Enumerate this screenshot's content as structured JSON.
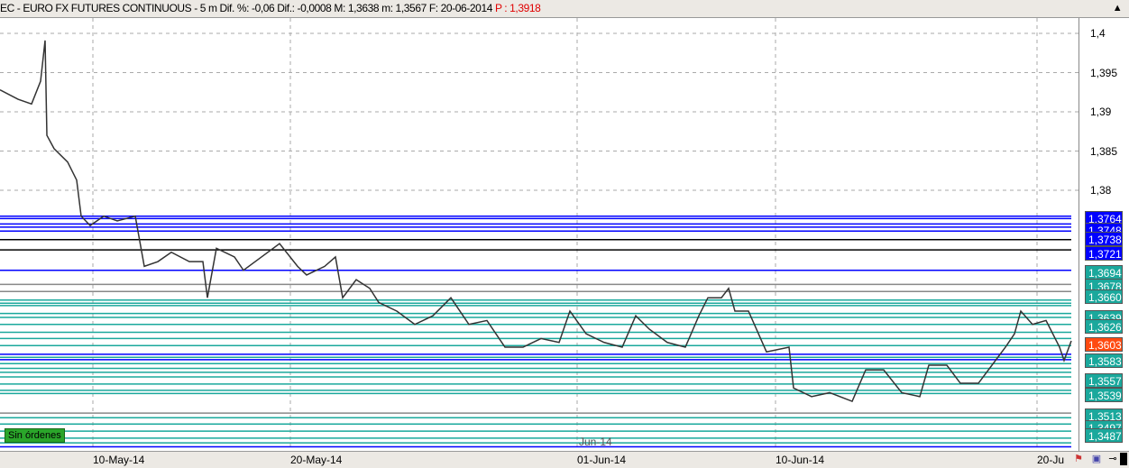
{
  "header": {
    "symbol": "EC - EURO FX FUTURES CONTINUOUS",
    "interval": "5 m",
    "dif_pct": "Dif. %: -0,06",
    "dif": "Dif.: -0,0008",
    "max": "M: 1,3638",
    "min": "m: 1,3567",
    "date": "F: 20-06-2014",
    "price": "P : 1,3918"
  },
  "y_axis": {
    "ticks": [
      "1,4",
      "1,395",
      "1,39",
      "1,385",
      "1,38"
    ],
    "tick_values": [
      1.4,
      1.395,
      1.39,
      1.385,
      1.38
    ]
  },
  "x_axis": {
    "labels": [
      "10-May-14",
      "20-May-14",
      "01-Jun-14",
      "10-Jun-14",
      "20-Ju"
    ],
    "marker": "Jun-14"
  },
  "orders_badge": "Sin órdenes",
  "colors": {
    "blue": "#0000ff",
    "teal": "#1aa89c",
    "orange": "#ff4a10",
    "black": "#000000"
  },
  "chart_data": {
    "type": "line",
    "ylim": [
      1.3465,
      1.4045
    ],
    "t_range": [
      0,
      1188
    ],
    "series": [
      [
        0,
        1.3928
      ],
      [
        20,
        1.3916
      ],
      [
        35,
        1.391
      ],
      [
        45,
        1.3939
      ],
      [
        50,
        1.3991
      ],
      [
        52,
        1.387
      ],
      [
        60,
        1.3853
      ],
      [
        75,
        1.3836
      ],
      [
        85,
        1.3813
      ],
      [
        90,
        1.3767
      ],
      [
        100,
        1.3755
      ],
      [
        115,
        1.3767
      ],
      [
        130,
        1.3761
      ],
      [
        150,
        1.3767
      ],
      [
        160,
        1.3703
      ],
      [
        175,
        1.3709
      ],
      [
        190,
        1.3721
      ],
      [
        210,
        1.3709
      ],
      [
        225,
        1.3709
      ],
      [
        230,
        1.3663
      ],
      [
        240,
        1.3726
      ],
      [
        260,
        1.3715
      ],
      [
        270,
        1.3698
      ],
      [
        290,
        1.3715
      ],
      [
        310,
        1.3732
      ],
      [
        330,
        1.3703
      ],
      [
        340,
        1.3692
      ],
      [
        360,
        1.3703
      ],
      [
        372,
        1.3715
      ],
      [
        380,
        1.3663
      ],
      [
        395,
        1.3686
      ],
      [
        410,
        1.3675
      ],
      [
        420,
        1.3657
      ],
      [
        440,
        1.3646
      ],
      [
        460,
        1.3629
      ],
      [
        480,
        1.364
      ],
      [
        500,
        1.3663
      ],
      [
        520,
        1.3629
      ],
      [
        540,
        1.3634
      ],
      [
        560,
        1.36
      ],
      [
        580,
        1.36
      ],
      [
        600,
        1.3611
      ],
      [
        620,
        1.3606
      ],
      [
        632,
        1.3646
      ],
      [
        650,
        1.3617
      ],
      [
        670,
        1.3606
      ],
      [
        690,
        1.36
      ],
      [
        705,
        1.364
      ],
      [
        720,
        1.3623
      ],
      [
        740,
        1.3606
      ],
      [
        760,
        1.36
      ],
      [
        775,
        1.364
      ],
      [
        785,
        1.3663
      ],
      [
        800,
        1.3663
      ],
      [
        808,
        1.3675
      ],
      [
        815,
        1.3646
      ],
      [
        830,
        1.3646
      ],
      [
        850,
        1.3594
      ],
      [
        875,
        1.36
      ],
      [
        880,
        1.3548
      ],
      [
        900,
        1.3537
      ],
      [
        920,
        1.3542
      ],
      [
        945,
        1.3531
      ],
      [
        960,
        1.3571
      ],
      [
        980,
        1.3571
      ],
      [
        1000,
        1.3542
      ],
      [
        1020,
        1.3537
      ],
      [
        1030,
        1.3577
      ],
      [
        1050,
        1.3577
      ],
      [
        1065,
        1.3554
      ],
      [
        1085,
        1.3554
      ],
      [
        1100,
        1.3577
      ],
      [
        1115,
        1.36
      ],
      [
        1125,
        1.3617
      ],
      [
        1132,
        1.3646
      ],
      [
        1145,
        1.3629
      ],
      [
        1160,
        1.3634
      ],
      [
        1175,
        1.36
      ],
      [
        1180,
        1.3583
      ],
      [
        1188,
        1.3608
      ]
    ],
    "levels": [
      {
        "p": 1.3767,
        "c": "blue"
      },
      {
        "p": 1.3764,
        "c": "blue"
      },
      {
        "p": 1.3757,
        "c": "blue"
      },
      {
        "p": 1.3753,
        "c": "blue"
      },
      {
        "p": 1.3748,
        "c": "blue"
      },
      {
        "p": 1.3737,
        "c": "black"
      },
      {
        "p": 1.3724,
        "c": "black"
      },
      {
        "p": 1.3698,
        "c": "blue"
      },
      {
        "p": 1.368,
        "c": "gray"
      },
      {
        "p": 1.3671,
        "c": "gray"
      },
      {
        "p": 1.366,
        "c": "teal"
      },
      {
        "p": 1.3656,
        "c": "teal"
      },
      {
        "p": 1.3653,
        "c": "teal"
      },
      {
        "p": 1.3643,
        "c": "teal"
      },
      {
        "p": 1.3638,
        "c": "teal"
      },
      {
        "p": 1.3629,
        "c": "teal"
      },
      {
        "p": 1.3619,
        "c": "teal"
      },
      {
        "p": 1.3611,
        "c": "teal"
      },
      {
        "p": 1.3602,
        "c": "teal"
      },
      {
        "p": 1.3591,
        "c": "blue"
      },
      {
        "p": 1.3587,
        "c": "teal"
      },
      {
        "p": 1.3584,
        "c": "blue"
      },
      {
        "p": 1.3579,
        "c": "teal"
      },
      {
        "p": 1.3573,
        "c": "teal"
      },
      {
        "p": 1.3568,
        "c": "teal"
      },
      {
        "p": 1.3562,
        "c": "teal"
      },
      {
        "p": 1.3553,
        "c": "teal"
      },
      {
        "p": 1.3545,
        "c": "teal"
      },
      {
        "p": 1.3541,
        "c": "teal"
      },
      {
        "p": 1.3516,
        "c": "gray"
      },
      {
        "p": 1.351,
        "c": "teal"
      },
      {
        "p": 1.3502,
        "c": "teal"
      },
      {
        "p": 1.3493,
        "c": "teal"
      },
      {
        "p": 1.3484,
        "c": "teal"
      },
      {
        "p": 1.3478,
        "c": "teal"
      },
      {
        "p": 1.3473,
        "c": "blue"
      }
    ],
    "price_labels": [
      {
        "t": "1,3764",
        "p": 1.3764,
        "c": "blue"
      },
      {
        "t": "1,3748",
        "p": 1.3749,
        "c": "blue"
      },
      {
        "t": "1,3738",
        "p": 1.3738,
        "c": "blue"
      },
      {
        "t": "1,3721",
        "p": 1.372,
        "c": "blue"
      },
      {
        "t": "1,3694",
        "p": 1.3695,
        "c": "teal"
      },
      {
        "t": "1,3678",
        "p": 1.3678,
        "c": "teal"
      },
      {
        "t": "1,3660",
        "p": 1.3664,
        "c": "teal"
      },
      {
        "t": "1,3639",
        "p": 1.3638,
        "c": "teal"
      },
      {
        "t": "1,3626",
        "p": 1.3626,
        "c": "teal"
      },
      {
        "t": "1,3603",
        "p": 1.3603,
        "c": "orange"
      },
      {
        "t": "1,3583",
        "p": 1.3583,
        "c": "teal"
      },
      {
        "t": "1,3557",
        "p": 1.3557,
        "c": "teal"
      },
      {
        "t": "1,3539",
        "p": 1.3539,
        "c": "teal"
      },
      {
        "t": "1,3513",
        "p": 1.3513,
        "c": "teal"
      },
      {
        "t": "1,3497",
        "p": 1.3498,
        "c": "teal"
      },
      {
        "t": "1,3487",
        "p": 1.3487,
        "c": "teal"
      }
    ]
  }
}
